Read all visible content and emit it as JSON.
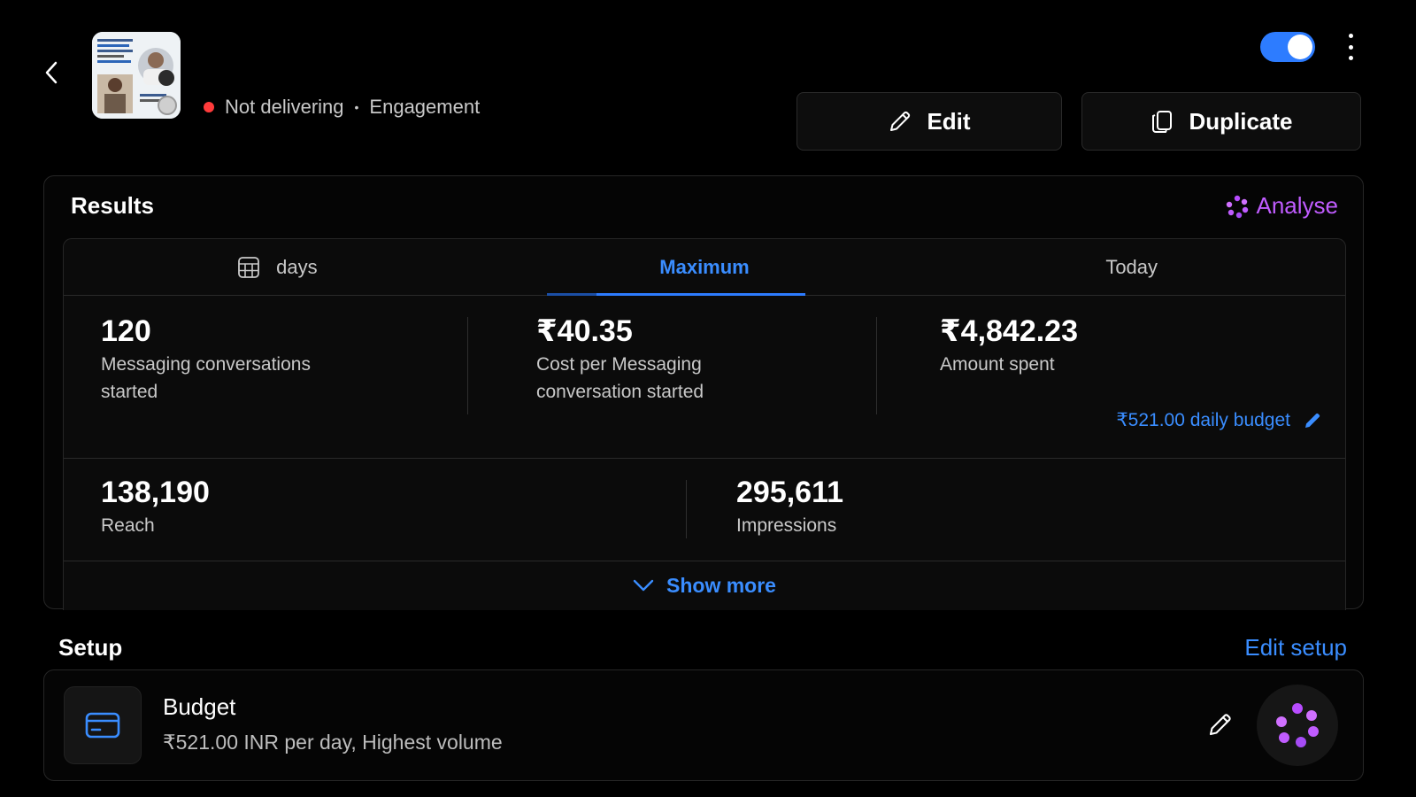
{
  "colors": {
    "accent_blue": "#3a8dff",
    "status_red": "#ff3b3b",
    "analyse_purple": "#c05cff",
    "toggle_blue": "#2d7cff"
  },
  "header": {
    "back_icon": "chevron-left-icon",
    "status": {
      "text": "Not delivering",
      "separator": "•",
      "objective": "Engagement"
    },
    "toggle_on": true,
    "menu_icon": "kebab-menu-icon",
    "edit_label": "Edit",
    "duplicate_label": "Duplicate"
  },
  "results": {
    "title": "Results",
    "analyse_label": "Analyse",
    "tabs": [
      {
        "label": "days",
        "icon": "calendar-icon",
        "active": false
      },
      {
        "label": "Maximum",
        "active": true
      },
      {
        "label": "Today",
        "active": false
      }
    ],
    "metrics": [
      {
        "value": "120",
        "label_line1": "Messaging conversations",
        "label_line2": "started"
      },
      {
        "value": "₹40.35",
        "label_line1": "Cost per Messaging",
        "label_line2": "conversation started"
      },
      {
        "value": "₹4,842.23",
        "label_line1": "Amount spent",
        "label_line2": ""
      }
    ],
    "daily_budget": "₹521.00 daily budget",
    "metrics2": [
      {
        "value": "138,190",
        "label": "Reach"
      },
      {
        "value": "295,611",
        "label": "Impressions"
      }
    ],
    "show_more": "Show more"
  },
  "setup": {
    "title": "Setup",
    "edit_label": "Edit setup",
    "budget": {
      "title": "Budget",
      "subtitle": "₹521.00 INR per day, Highest volume",
      "icon": "credit-card-icon"
    }
  }
}
